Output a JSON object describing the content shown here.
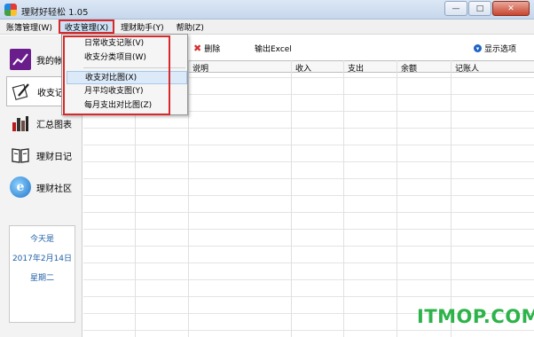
{
  "window": {
    "title": "理财好轻松 1.05",
    "buttons": [
      "—",
      "□",
      "✕"
    ]
  },
  "menubar": {
    "items": [
      "账簿管理(W)",
      "收支管理(X)",
      "理财助手(Y)",
      "帮助(Z)"
    ]
  },
  "dropdown": {
    "items": [
      "日常收支记账(V)",
      "收支分类项目(W)",
      "收支对比图(X)",
      "月平均收支图(Y)",
      "每月支出对比图(Z)"
    ],
    "highlighted_index": 2
  },
  "sidebar": {
    "items": [
      "我的帐",
      "收支记",
      "汇总图表",
      "理财日记",
      "理财社区"
    ],
    "selected_index": 1
  },
  "datebox": {
    "line1": "今天是",
    "line2": "2017年2月14日",
    "line3": "星期二"
  },
  "toolbar": {
    "delete_label": "删除",
    "export_label": "输出Excel",
    "options_label": "显示选项"
  },
  "table": {
    "columns": [
      "说明",
      "收入",
      "支出",
      "余额",
      "记账人"
    ]
  },
  "watermark": "ITMOP.COM"
}
